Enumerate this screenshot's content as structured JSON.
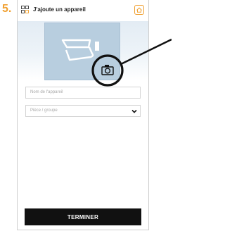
{
  "step": {
    "number": "5."
  },
  "header": {
    "title": "J'ajoute un appareil",
    "app_icon": "grid-icon",
    "home_icon": "home-icon"
  },
  "device_photo": {
    "icon": "camera-device-icon",
    "camera_button_icon": "camera-icon"
  },
  "form": {
    "device_name_placeholder": "Nom de l'appareil",
    "room_select_placeholder": "Pièce / groupe",
    "room_select_icon": "chevron-down-icon"
  },
  "actions": {
    "finish_label": "TERMINER"
  },
  "colors": {
    "accent": "#f0a030",
    "photo_bg": "#b8cedf",
    "button_bg": "#111111"
  }
}
